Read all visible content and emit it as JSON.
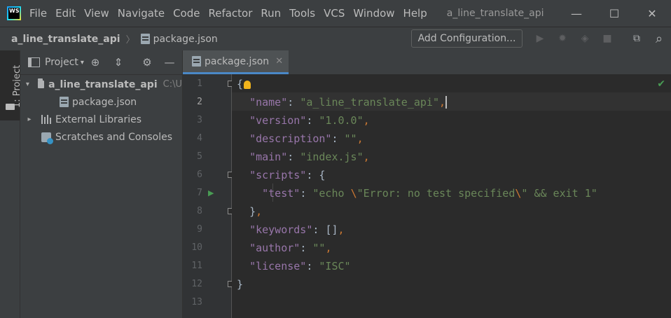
{
  "app": {
    "logo_text": "WS",
    "window_title": "a_line_translate_api"
  },
  "menu": [
    "File",
    "Edit",
    "View",
    "Navigate",
    "Code",
    "Refactor",
    "Run",
    "Tools",
    "VCS",
    "Window",
    "Help"
  ],
  "window_controls": {
    "minimize": "—",
    "maximize": "☐",
    "close": "✕"
  },
  "breadcrumb": {
    "project": "a_line_translate_api",
    "separator": "〉",
    "file": "package.json"
  },
  "toolbar": {
    "add_configuration": "Add Configuration...",
    "run": "▶",
    "debug": "✹",
    "coverage": "◈",
    "stop": "■",
    "terminal": "⧉",
    "search": "⌕"
  },
  "left_strip": {
    "tab_label": "1: Project"
  },
  "project_panel": {
    "title": "Project",
    "caret": "▾",
    "tools": {
      "locate": "⊕",
      "collapse": "⇕",
      "settings": "⚙",
      "hide": "—"
    },
    "tree": [
      {
        "label": "a_line_translate_api",
        "hint": "C:\\U",
        "expanded": true
      },
      {
        "label": "package.json"
      },
      {
        "label": "External Libraries",
        "expanded": false
      },
      {
        "label": "Scratches and Consoles"
      }
    ],
    "arrows": {
      "expanded": "▾",
      "collapsed": "▸"
    }
  },
  "editor": {
    "tab_label": "package.json",
    "tab_close": "✕",
    "inspection_ok": "✔",
    "current_line": 2,
    "run_marker_line": 7,
    "run_marker": "▶",
    "line_numbers": [
      "1",
      "2",
      "3",
      "4",
      "5",
      "6",
      "7",
      "8",
      "9",
      "10",
      "11",
      "12",
      "13"
    ],
    "code": {
      "l1_open": "{",
      "l2_key": "\"name\"",
      "l2_colon": ": ",
      "l2_val": "\"a_line_translate_api\"",
      "l2_comma": ",",
      "l3_key": "\"version\"",
      "l3_colon": ": ",
      "l3_val": "\"1.0.0\"",
      "l3_comma": ",",
      "l4_key": "\"description\"",
      "l4_colon": ": ",
      "l4_val": "\"\"",
      "l4_comma": ",",
      "l5_key": "\"main\"",
      "l5_colon": ": ",
      "l5_val": "\"index.js\"",
      "l5_comma": ",",
      "l6_key": "\"scripts\"",
      "l6_colon": ": ",
      "l6_brace": "{",
      "l7_key": "\"test\"",
      "l7_colon": ": ",
      "l7_val_a": "\"echo ",
      "l7_esc1": "\\",
      "l7_val_b": "\"Error: no test specified",
      "l7_esc2": "\\",
      "l7_val_c": "\" && exit 1\"",
      "l8_close": "}",
      "l8_comma": ",",
      "l9_key": "\"keywords\"",
      "l9_colon": ": ",
      "l9_val": "[]",
      "l9_comma": ",",
      "l10_key": "\"author\"",
      "l10_colon": ": ",
      "l10_val": "\"\"",
      "l10_comma": ",",
      "l11_key": "\"license\"",
      "l11_colon": ": ",
      "l11_val": "\"ISC\"",
      "l12_close": "}"
    }
  }
}
